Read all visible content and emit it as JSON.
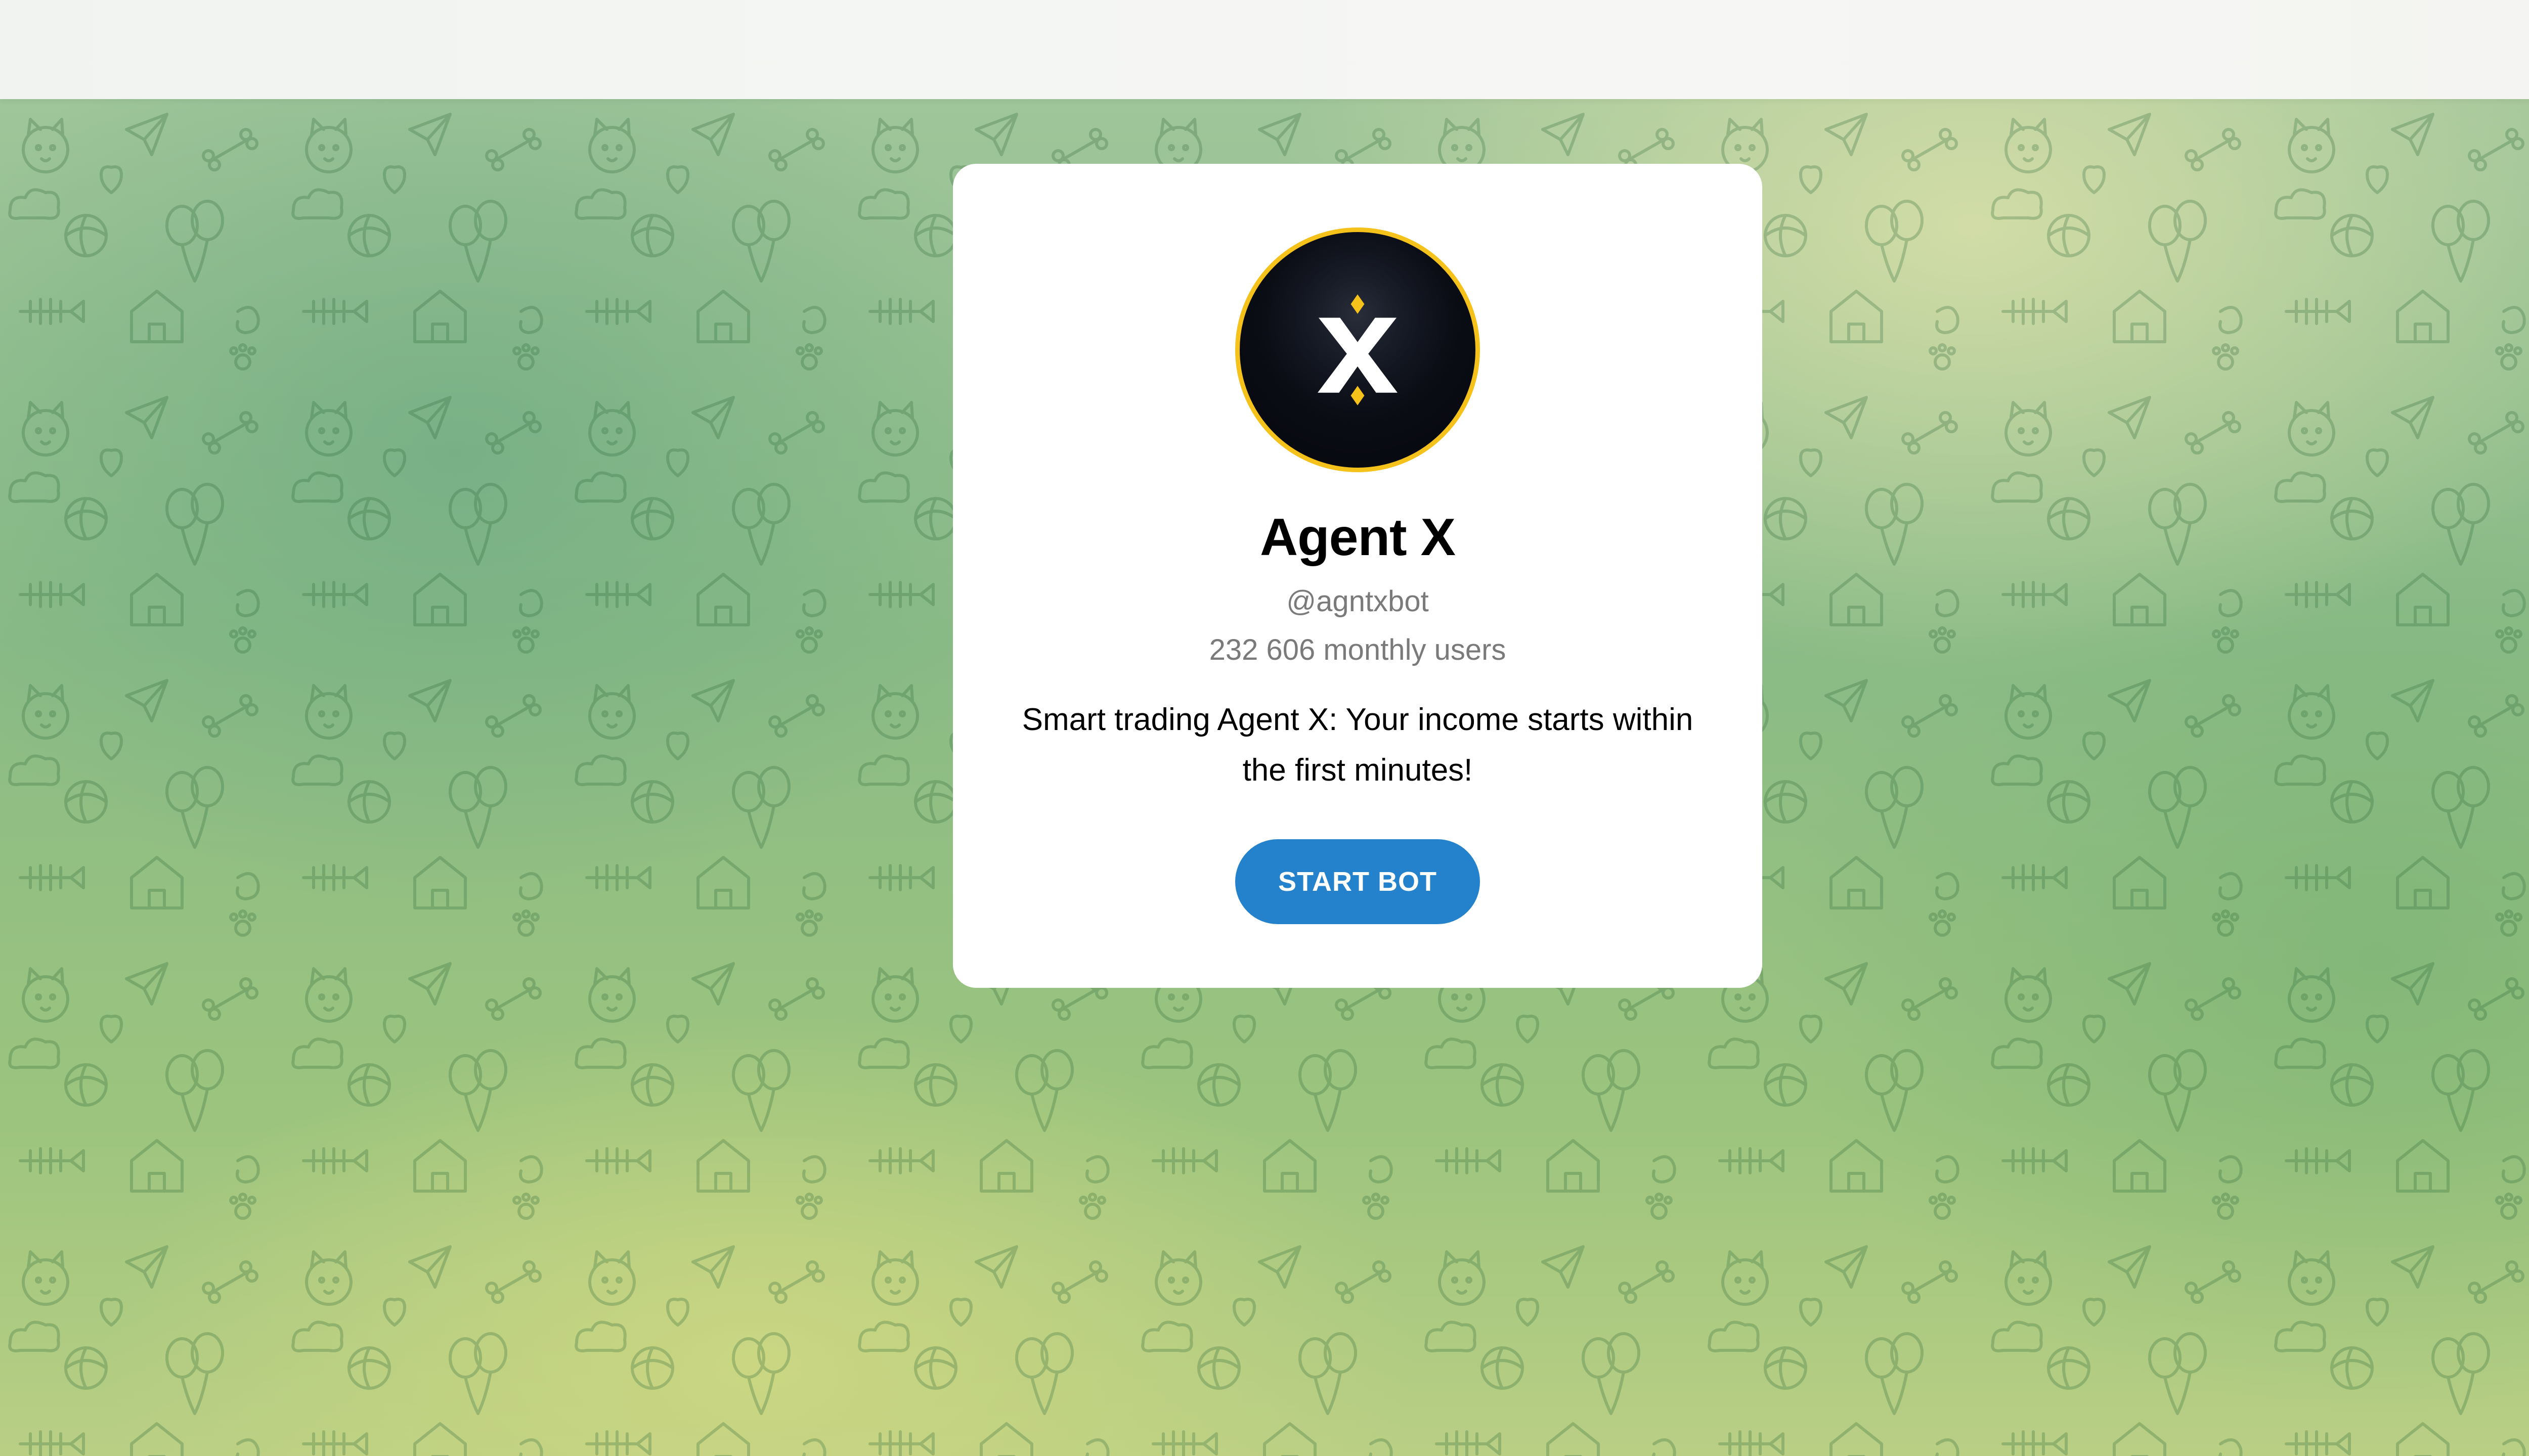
{
  "bot": {
    "name": "Agent X",
    "username": "@agntxbot",
    "monthly_users": "232 606 monthly users",
    "description": "Smart trading Agent X: Your income starts within the first minutes!",
    "start_label": "START BOT"
  },
  "avatar": {
    "icon": "agent-x-logo",
    "border_color": "#f4c21b",
    "background_color": "#0a0c14"
  },
  "colors": {
    "button": "#2481cc",
    "card": "#ffffff",
    "background": "#8abb86"
  }
}
